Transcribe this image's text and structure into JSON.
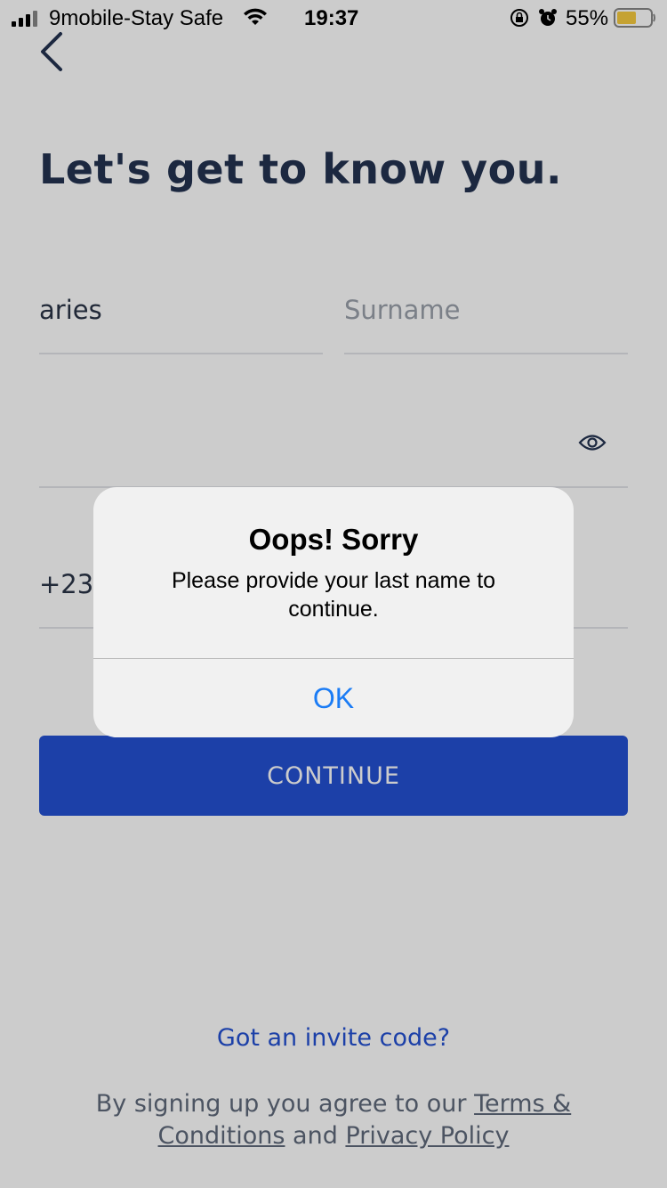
{
  "status_bar": {
    "carrier": "9mobile-Stay Safe",
    "time": "19:37",
    "battery": "55%"
  },
  "page": {
    "title": "Let's get to know you."
  },
  "form": {
    "first_name_value": "aries",
    "surname_placeholder": "Surname",
    "phone_value": "+234"
  },
  "buttons": {
    "continue_label": "CONTINUE"
  },
  "footer": {
    "invite_link": "Got an invite code?",
    "legal_prefix": "By signing up you agree to our",
    "terms_link": "Terms & Conditions",
    "and_text": "and",
    "privacy_link": "Privacy Policy"
  },
  "alert": {
    "title": "Oops! Sorry",
    "message": "Please provide your last name to continue.",
    "ok_label": "OK"
  },
  "colors": {
    "primary": "#2350d2",
    "title": "#233350",
    "ios_link": "#1b7cf5",
    "battery_fill": "#f7cb3f"
  }
}
